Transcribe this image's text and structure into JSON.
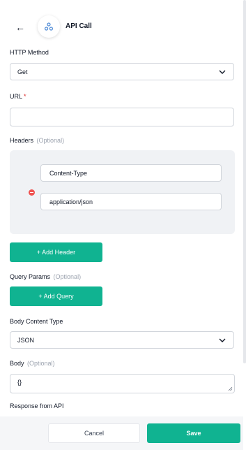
{
  "header": {
    "back_icon": "arrow-left-icon",
    "node_icon": "webhook-icon",
    "title": "API Call"
  },
  "http_method": {
    "label": "HTTP Method",
    "value": "Get"
  },
  "url": {
    "label": "URL",
    "required_mark": "*",
    "value": ""
  },
  "headers": {
    "label": "Headers",
    "optional": "(Optional)",
    "key": "Content-Type",
    "value": "application/json",
    "add_label": "+ Add Header"
  },
  "query_params": {
    "label": "Query Params",
    "optional": "(Optional)",
    "add_label": "+ Add Query"
  },
  "body_content_type": {
    "label": "Body Content Type",
    "value": "JSON"
  },
  "body": {
    "label": "Body",
    "optional": "(Optional)",
    "value": "{}"
  },
  "response": {
    "label": "Response from API"
  },
  "footer": {
    "cancel_label": "Cancel",
    "save_label": "Save"
  },
  "colors": {
    "accent": "#10b391",
    "danger": "#ef5350",
    "required": "#dc2626"
  }
}
